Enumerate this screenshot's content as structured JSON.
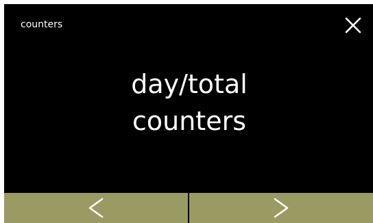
{
  "header": {
    "title": "counters"
  },
  "main": {
    "line1": "day/total",
    "line2": "counters"
  },
  "icons": {
    "close": "close-icon",
    "prev": "chevron-left-icon",
    "next": "chevron-right-icon"
  },
  "colors": {
    "background": "#000000",
    "text": "#ffffff",
    "nav_button": "#9a9a63"
  }
}
